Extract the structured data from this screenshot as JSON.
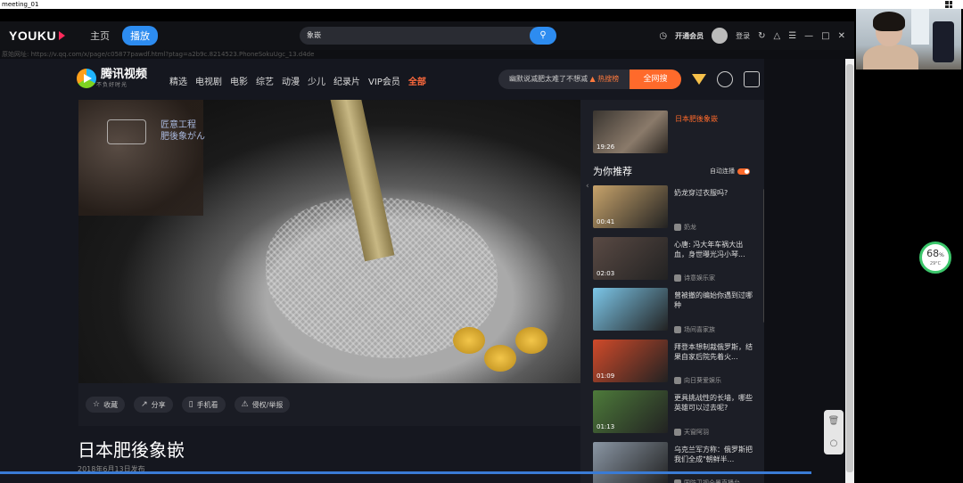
{
  "meeting": {
    "title": "meeting_01"
  },
  "youku": {
    "logo": "YOUKU",
    "nav_home": "主页",
    "nav_play": "播放",
    "search_value": "象嵌",
    "vip": "开通会员",
    "login": "登录"
  },
  "url": "原始网址: https://v.qq.com/x/page/c05877pawdf.html?ptag=a2b9c.8214523.PhoneSokuUgc_13.d4de",
  "tencent": {
    "logo_name": "腾讯视频",
    "slogan": "不负好时光",
    "nav": [
      "精选",
      "电视剧",
      "电影",
      "综艺",
      "动漫",
      "少儿",
      "纪录片",
      "VIP会员"
    ],
    "nav_all": "全部",
    "search_placeholder": "幽默说减肥太难了不想减",
    "hot_label": "热搜榜",
    "search_button": "全网搜"
  },
  "video": {
    "watermark_line1": "匠意工程",
    "watermark_line2": "肥後象がん",
    "actions": [
      {
        "icon": "star-icon",
        "label": "收藏"
      },
      {
        "icon": "share-icon",
        "label": "分享"
      },
      {
        "icon": "phone-icon",
        "label": "手机看"
      },
      {
        "icon": "warning-icon",
        "label": "侵权/举报"
      }
    ]
  },
  "page": {
    "title": "日本肥後象嵌",
    "date": "2018年6月13日发布"
  },
  "sidebar": {
    "current": {
      "title": "日本肥後象嵌",
      "duration": "19:26"
    },
    "recommend_heading": "为你推荐",
    "autoplay_label": "自动连播",
    "items": [
      {
        "title": "奶龙穿过衣服吗?",
        "uploader": "奶龙",
        "duration": "00:41",
        "color": "#c7a36b"
      },
      {
        "title": "心唐: 冯大年车祸大出血，身世曝光冯小琴...",
        "uploader": "诗意娱乐家",
        "duration": "02:03",
        "color": "#5a4a44"
      },
      {
        "title": "曾被撤的编始你遇到过哪种",
        "uploader": "场间喜家族",
        "duration": "",
        "color": "#7cc6e8"
      },
      {
        "title": "拜登本想制裁俄罗斯，结果自家后院先着火...",
        "uploader": "向日葵爱娱乐",
        "duration": "01:09",
        "color": "#d04a2a"
      },
      {
        "title": "更具挑战性的长墙，哪些英雄可以过去呢?",
        "uploader": "天窗阿羽",
        "duration": "01:13",
        "color": "#4d7a3a"
      },
      {
        "title": "乌克兰军方称：俄罗斯把我们全成\"朝鲜半...",
        "uploader": "国防卫视全景直播台",
        "duration": "",
        "color": "#8a96a4"
      }
    ]
  },
  "battery": {
    "percent": "68",
    "unit": "%",
    "temp": "29°C"
  }
}
